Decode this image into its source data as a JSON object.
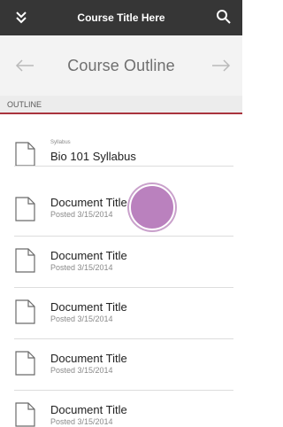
{
  "header": {
    "title": "Course Title Here",
    "menu_icon": "double-chevron-down-icon",
    "search_icon": "search-icon"
  },
  "nav": {
    "title": "Course Outline",
    "back_icon": "arrow-left-icon",
    "forward_icon": "arrow-right-icon"
  },
  "section": {
    "label": "OUTLINE",
    "accent_color": "#a9333d"
  },
  "items": [
    {
      "kicker": "Syllabus",
      "title": "Bio 101 Syllabus",
      "date": ""
    },
    {
      "kicker": "",
      "title": "Document Title",
      "date": "Posted 3/15/2014"
    },
    {
      "kicker": "",
      "title": "Document Title",
      "date": "Posted 3/15/2014"
    },
    {
      "kicker": "",
      "title": "Document Title",
      "date": "Posted 3/15/2014"
    },
    {
      "kicker": "",
      "title": "Document Title",
      "date": "Posted 3/15/2014"
    },
    {
      "kicker": "",
      "title": "Document Title",
      "date": "Posted 3/15/2014"
    }
  ],
  "touch_color": "#b77bbb"
}
